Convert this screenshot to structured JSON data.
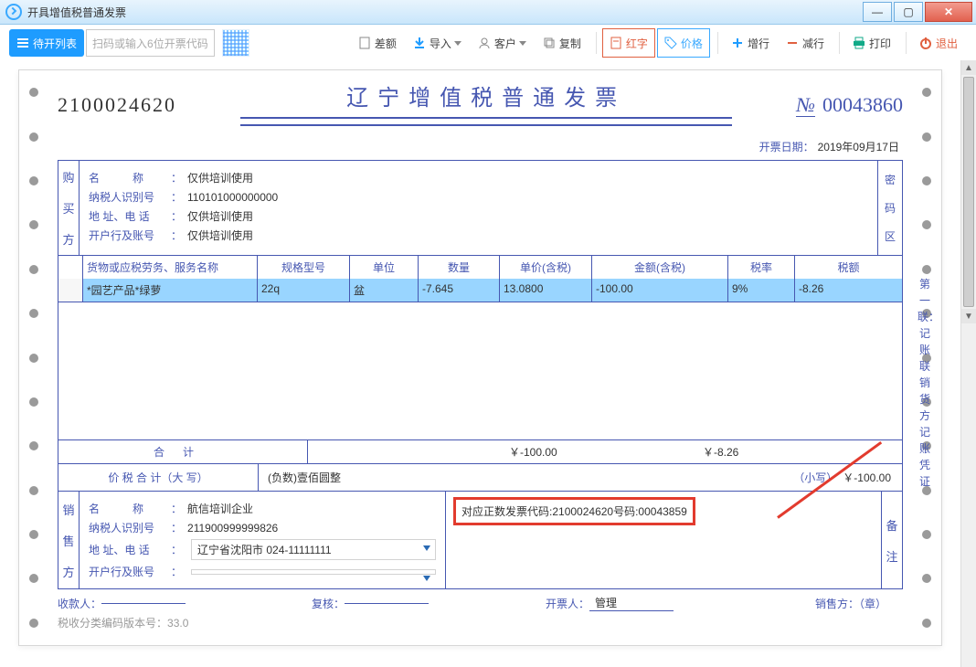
{
  "window": {
    "title": "开具增值税普通发票"
  },
  "toolbar": {
    "pending": "待开列表",
    "search_placeholder": "扫码或输入6位开票代码",
    "diff": "差额",
    "import": "导入",
    "customer": "客户",
    "copy": "复制",
    "red": "红字",
    "price": "价格",
    "addrow": "增行",
    "delrow": "减行",
    "print": "打印",
    "exit": "退出"
  },
  "invoice": {
    "code": "2100024620",
    "title": "辽宁增值税普通发票",
    "no_label": "№",
    "number": "00043860",
    "date_label": "开票日期：",
    "date": "2019年09月17日",
    "buyer": {
      "tab": "购\n\n买\n\n方",
      "name_l": "名　　　称",
      "name": "仅供培训使用",
      "tax_l": "纳税人识别号",
      "tax": "110101000000000",
      "addr_l": "地 址、电 话",
      "addr": "仅供培训使用",
      "bank_l": "开户行及账号",
      "bank": "仅供培训使用",
      "code_tab": "密\n\n码\n\n区"
    },
    "ledger": "第一联：记账联 销货方记账凭证",
    "cols": {
      "chk": "",
      "name": "货物或应税劳务、服务名称",
      "spec": "规格型号",
      "unit": "单位",
      "qty": "数量",
      "price": "单价(含税)",
      "amt": "金额(含税)",
      "rate": "税率",
      "tax": "税额"
    },
    "item": {
      "name": "*园艺产品*绿萝",
      "spec": "22q",
      "unit": "盆",
      "qty": "-7.645",
      "price": "13.0800",
      "amt": "-100.00",
      "rate": "9%",
      "tax": "-8.26"
    },
    "sum": {
      "label": "合计",
      "amt": "￥-100.00",
      "tax": "￥-8.26"
    },
    "total": {
      "label": "价 税 合 计（大 写）",
      "cn": "(负数)壹佰圆整",
      "sm_label": "（小写）",
      "sm": "￥-100.00"
    },
    "seller": {
      "tab": "销\n\n售\n\n方",
      "name_l": "名　　　称",
      "name": "航信培训企业",
      "tax_l": "纳税人识别号",
      "tax": "211900999999826",
      "addr_l": "地 址、电 话",
      "addr": "辽宁省沈阳市 024-11111111",
      "bank_l": "开户行及账号",
      "bank": "",
      "remark_tab": "备\n\n注",
      "remark": "对应正数发票代码:2100024620号码:00043859"
    },
    "footer": {
      "payee": "收款人：",
      "review": "复核：",
      "issuer": "开票人：",
      "issuer_v": "管理",
      "stamp": "销售方：（章）"
    },
    "version_l": "税收分类编码版本号：",
    "version": "33.0"
  }
}
